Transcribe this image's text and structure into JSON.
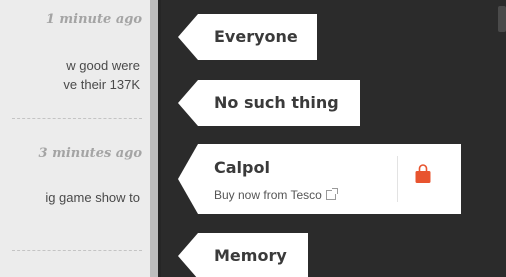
{
  "feed": {
    "items": [
      {
        "time": "1 minute ago",
        "lines": [
          "w good were",
          "ve their 137K"
        ]
      },
      {
        "time": "3 minutes ago",
        "lines": [
          "ig game show to"
        ]
      }
    ]
  },
  "tags": [
    {
      "label": "Everyone"
    },
    {
      "label": "No such thing"
    },
    {
      "label": "Calpol",
      "sub": "Buy now from Tesco",
      "icon": "shopping-bag-icon",
      "icon_color": "#e8542f"
    },
    {
      "label": "Memory"
    }
  ],
  "colors": {
    "panel_bg": "#2b2b2b",
    "feed_bg": "#ececec",
    "tag_bg": "#ffffff",
    "bag_orange": "#e8542f"
  }
}
